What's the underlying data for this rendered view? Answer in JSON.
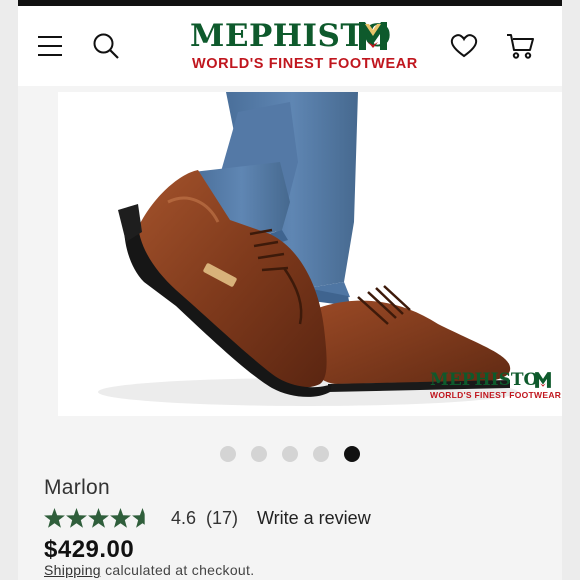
{
  "brand": {
    "name": "MEPHISTO",
    "tagline": "WORLD'S FINEST FOOTWEAR",
    "green": "#0e5a2c",
    "red": "#c0161e"
  },
  "header": {
    "icons": [
      "menu-icon",
      "search-icon",
      "heart-icon",
      "cart-icon"
    ]
  },
  "gallery": {
    "image_alt": "Brown leather lace-up Mephisto shoe worn with blue jeans",
    "slide_count": 5,
    "active_slide": 5
  },
  "product": {
    "name": "Marlon",
    "rating": "4.6",
    "rating_value": 4.6,
    "review_count": "(17)",
    "write_review": "Write a review",
    "price": "$429.00",
    "shipping_link": "Shipping",
    "shipping_text": " calculated at checkout."
  },
  "colors": {
    "star": "#2f5e3b",
    "active_dot": "#111111",
    "inactive_dot": "#d4d4d4"
  }
}
